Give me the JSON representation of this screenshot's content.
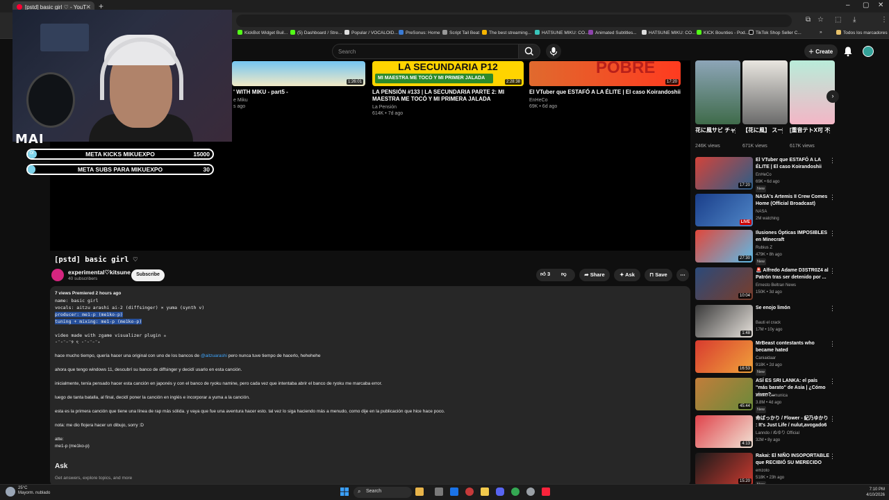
{
  "browser": {
    "tab_title": "[pstd] basic girl ♡ - YouT",
    "bookmarks": [
      "KickBot Widget Buil...",
      "(5) Dashboard / Stre...",
      "Popular / VOCALOID...",
      "PreSonus: Home",
      "Script Tail Beat",
      "The best streaming...",
      "HATSUNE MIKU: CO...",
      "Animated Subtitles...",
      "HATSUNE MIKU: CO...",
      "KICK Bounties - Pod...",
      "TikTok Shop Seller C..."
    ],
    "all_bookmarks": "Todos los marcadores"
  },
  "header": {
    "search_placeholder": "Search",
    "create_label": "Create"
  },
  "overlay": {
    "streamer_tag": "MAI",
    "goals": [
      {
        "label": "META KICKS MIKUEXPO",
        "target": "15000",
        "current": "0/",
        "fraction": 0.05,
        "color": "#7fd3ea"
      },
      {
        "label": "META SUBS PARA MIKUEXPO",
        "target": "30",
        "current": "",
        "fraction": 0.02,
        "color": "#7fd3ea"
      }
    ]
  },
  "endcards": [
    {
      "title_line1": "' WITH MIKU - part5 -",
      "title_line2": "",
      "channel": "e Miku",
      "meta": "s ago",
      "duration": "1:26:01",
      "colors": [
        "#74c5f2",
        "#f2e9c6"
      ]
    },
    {
      "title_line1": "LA PENSIÓN #133 | LA SECUNDARIA PARTE 2: MI",
      "title_line2": "MAESTRA ME TOCÓ Y MI PRIMERA JALADA",
      "channel": "La Pensión",
      "meta": "614K • 7d ago",
      "duration": "2:28:38",
      "banner": "LA SECUNDARIA P12",
      "banner2": "MI MAESTRA ME TOCÓ Y MI PRIMER JALADA",
      "colors": [
        "#ffd400",
        "#2d8a2a"
      ]
    },
    {
      "title_line1": "El VTuber que ESTAFÓ A LA ÉLITE | El caso Koirandoshii",
      "title_line2": "",
      "channel": "EnHeCo",
      "meta": "69K • 6d ago",
      "duration": "17:20",
      "banner": "POBRE",
      "colors": [
        "#ff3b1f",
        "#e06a2e"
      ]
    }
  ],
  "video": {
    "title": "[pstd] basic girl ♡",
    "channel": "experimental♡kitsune",
    "subscribers": "40 subscribers",
    "subscribe_label": "Subscribe",
    "likes": "3",
    "share_label": "Share",
    "ask_label": "Ask",
    "save_label": "Save"
  },
  "description": {
    "stats": "7 views  Premiered 2 hours ago",
    "name_line": "name: basic girl",
    "vocals_line": "vocals: aitzu arashi ai-2 (diffsinger) × yuma (synth v)",
    "producer_line": "producer: me1-p (me1ko-p)",
    "tuning_line": "tuning + mixing: me1-p (me1ko-p)",
    "plugin_line": "video made with zgame visualizer plugin ✮",
    "kaomoji_line": "ᵕ̈ ᵕ̈ ᵕ̈ ୨ ৎ ᵕ̈ ᵕ̈ ᵕ̈ ⋆",
    "p1_a": "hace mucho tiempo, quería hacer una original con uno de los bancos de ",
    "p1_link": "@aitzuarashi",
    "p1_b": " pero nunca tuve tiempo de hacerlo, hehehehe",
    "p2": "ahora que tengo windows 11, descubrí su banco de diffsinger y decidí usarlo en esta canción.",
    "p3": "inicialmente, tenía pensado hacer esta canción en japonés y con el banco de ryoku namine, pero cada vez que intentaba abrir el banco de ryoku me marcaba error.",
    "p4": "luego de tanta batalla, al final, decidí poner la canción en inglés e incorporar a yuma a la canción.",
    "p5": "esta es la primera canción que tiene una línea de rap más sólida. y vaya que fue una aventura hacer esto. tal vez lo siga haciendo más a menudo, como dije en la publicación que hice hace poco.",
    "p6": "nota: me dio flojera hacer un dibujo, sorry :D",
    "sign1": "atte:",
    "sign2": "me1-p (me1ko-p)"
  },
  "ask": {
    "heading": "Ask",
    "sub": "Get answers, explore topics, and more"
  },
  "shorts": [
    {
      "title": "花に風サビ チャレンジ...",
      "views": "246K views",
      "colors": [
        "#8da5b8",
        "#3f6b4a"
      ]
    },
    {
      "title": "【花に風】 スーツでバ...",
      "views": "671K views",
      "colors": [
        "#e9e6e0",
        "#6a6a6a"
      ]
    },
    {
      "title": "[重音テトX可 不X初音ミ...",
      "views": "617K views",
      "colors": [
        "#b9ecd9",
        "#f3b6c6"
      ]
    }
  ],
  "related": [
    {
      "title": "El VTuber que ESTAFÓ A LA ÉLITE | El caso Koirandoshii",
      "channel": "EnHeCo",
      "meta": "69K • 6d ago",
      "badge": "New",
      "duration": "17:20",
      "live": false,
      "colors": [
        "#d2433a",
        "#2b5e88"
      ]
    },
    {
      "title": "NASA's Artemis II Crew Comes Home (Official Broadcast)",
      "channel": "NASA",
      "meta": "2M watching",
      "badge": "",
      "duration": "LIVE",
      "live": true,
      "colors": [
        "#1a3e8a",
        "#4f86c7"
      ]
    },
    {
      "title": "Ilusiones Ópticas IMPOSIBLES en Minecraft",
      "channel": "Rubius Z",
      "meta": "479K • 8h ago",
      "badge": "New",
      "duration": "27:30",
      "live": false,
      "colors": [
        "#e1473b",
        "#5cbbe8"
      ]
    },
    {
      "title": "🚨 Alfredo Adame D3STR0Z4 al Patrón tras ser detenido por ...",
      "channel": "Ernesto Beltran News",
      "meta": "150K • 3d ago",
      "badge": "",
      "duration": "10:04",
      "live": false,
      "colors": [
        "#2b4a7a",
        "#7a3d2a"
      ]
    },
    {
      "title": "Se enojo limón",
      "channel": "Bauti el crack",
      "meta": "17M • 10y ago",
      "badge": "",
      "duration": "1:48",
      "live": false,
      "colors": [
        "#3a3a3a",
        "#e7e2dc"
      ]
    },
    {
      "title": "MrBeast contestants who became hated",
      "channel": "Caniaidaar",
      "meta": "918K • 2d ago",
      "badge": "New",
      "duration": "16:53",
      "live": false,
      "colors": [
        "#d83b2f",
        "#f0a23b"
      ]
    },
    {
      "title": "ASÍ ES SRI LANKA: el país \"más barato\" de Asia | ¿Cómo viven?...",
      "channel": "Luisito Comunica",
      "meta": "3.8M • 4d ago",
      "badge": "New",
      "duration": "45:44",
      "live": false,
      "colors": [
        "#c27d3a",
        "#6a8a3a"
      ]
    },
    {
      "title": "命ばっかり / Flower - 紀乃ゆかり : It's Just Life / nulut,avogado6",
      "channel": "Lanndo / ぬゆり Official",
      "meta": "32M • 8y ago",
      "badge": "",
      "duration": "4:13",
      "live": false,
      "colors": [
        "#e0434b",
        "#f1e3d5"
      ]
    },
    {
      "title": "Rakai: El NIÑO INSOPORTABLE que RECIBIÓ SU MERECIDO",
      "channel": "emzoto",
      "meta": "518K • 23h ago",
      "badge": "New",
      "duration": "15:20",
      "live": false,
      "colors": [
        "#1a1a1a",
        "#c9392f"
      ]
    }
  ],
  "taskbar": {
    "temp": "25°C",
    "weather": "Mayorm. nublado",
    "search_label": "Search",
    "time": "7:10 PM",
    "date": "4/10/2026"
  }
}
